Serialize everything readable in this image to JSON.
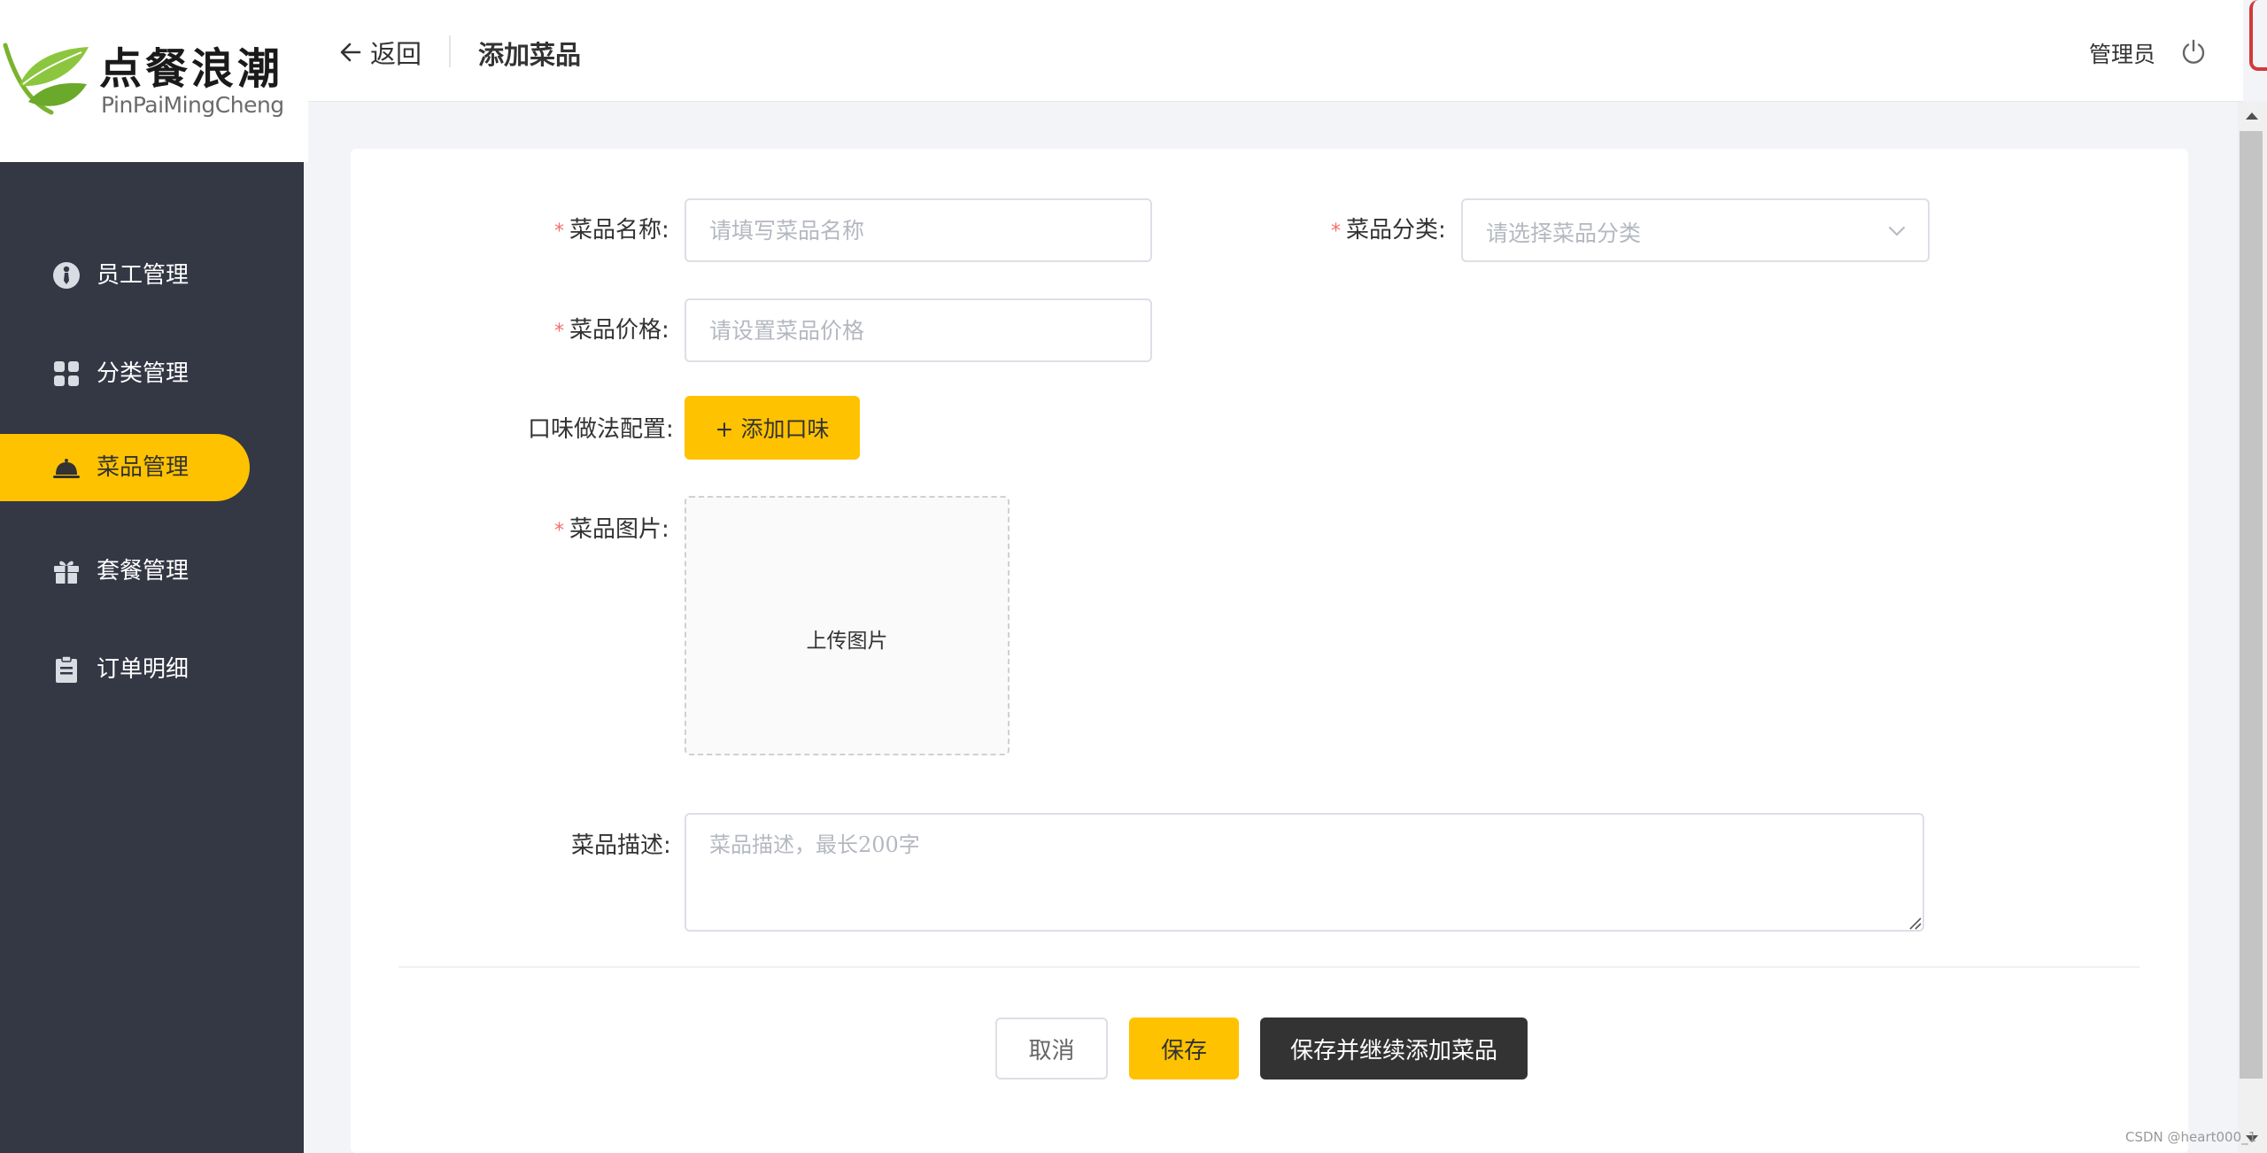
{
  "brand": {
    "name_cn": "点餐浪潮",
    "name_en": "PinPaiMingCheng"
  },
  "sidebar": {
    "items": [
      {
        "label": "员工管理",
        "icon": "user-tie-icon",
        "active": false
      },
      {
        "label": "分类管理",
        "icon": "grid-icon",
        "active": false
      },
      {
        "label": "菜品管理",
        "icon": "cloche-icon",
        "active": true
      },
      {
        "label": "套餐管理",
        "icon": "gift-icon",
        "active": false
      },
      {
        "label": "订单明细",
        "icon": "clipboard-icon",
        "active": false
      }
    ]
  },
  "header": {
    "back_label": "返回",
    "title": "添加菜品",
    "user": "管理员"
  },
  "form": {
    "name": {
      "label": "菜品名称:",
      "placeholder": "请填写菜品名称",
      "required": true
    },
    "category": {
      "label": "菜品分类:",
      "placeholder": "请选择菜品分类",
      "required": true
    },
    "price": {
      "label": "菜品价格:",
      "placeholder": "请设置菜品价格",
      "required": true
    },
    "flavor": {
      "label": "口味做法配置:",
      "button": "+ 添加口味"
    },
    "image": {
      "label": "菜品图片:",
      "upload_text": "上传图片",
      "required": true
    },
    "description": {
      "label": "菜品描述:",
      "placeholder": "菜品描述，最长200字"
    }
  },
  "actions": {
    "cancel": "取消",
    "save": "保存",
    "save_continue": "保存并继续添加菜品"
  },
  "watermark": "CSDN @heart000_1",
  "colors": {
    "accent": "#ffc200",
    "sidebar_bg": "#343744",
    "required": "#f56c6c",
    "dark_button": "#333333"
  }
}
